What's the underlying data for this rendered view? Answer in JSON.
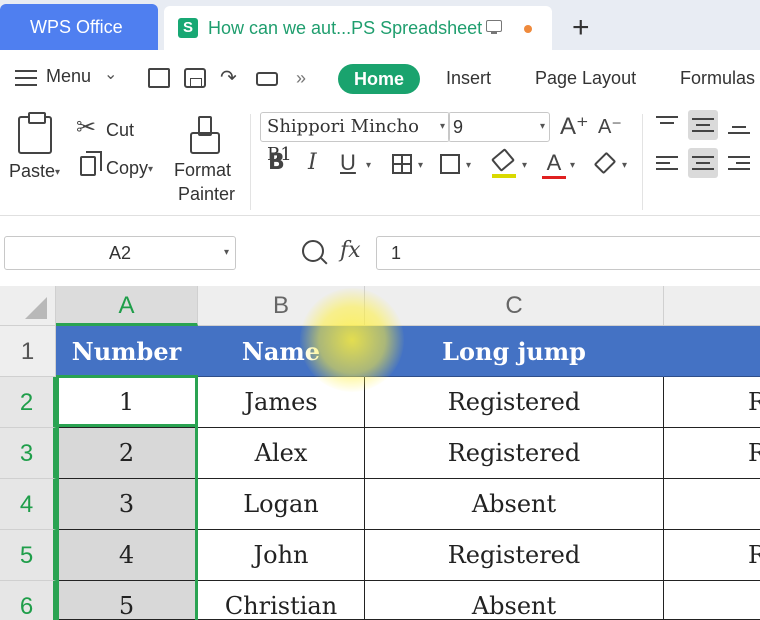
{
  "tabs": {
    "app_tab": "WPS Office",
    "doc_tab": "How can we aut...PS Spreadsheet",
    "new_tab": "+"
  },
  "menu": {
    "menu_label": "Menu",
    "tabs": [
      "Home",
      "Insert",
      "Page Layout",
      "Formulas"
    ],
    "active_tab": "Home"
  },
  "ribbon": {
    "paste": "Paste",
    "cut": "Cut",
    "copy": "Copy",
    "format_painter_line1": "Format",
    "format_painter_line2": "Painter",
    "font_name": "Shippori Mincho B1",
    "font_size": "9",
    "bold": "B",
    "italic": "I",
    "underline": "U",
    "font_color_glyph": "A",
    "grow_font": "A⁺",
    "shrink_font": "A⁻"
  },
  "formula_bar": {
    "name_box": "A2",
    "fx": "fx",
    "value": "1"
  },
  "grid": {
    "columns": [
      "A",
      "B",
      "C"
    ],
    "rows": [
      "1",
      "2",
      "3",
      "4",
      "5",
      "6"
    ],
    "selected_column": "A",
    "header_row": [
      "Number",
      "Name",
      "Long jump"
    ],
    "data_rows": [
      [
        "1",
        "James",
        "Registered",
        "R"
      ],
      [
        "2",
        "Alex",
        "Registered",
        "R"
      ],
      [
        "3",
        "Logan",
        "Absent",
        ""
      ],
      [
        "4",
        "John",
        "Registered",
        "R"
      ],
      [
        "5",
        "Christian",
        "Absent",
        ""
      ]
    ]
  },
  "colors": {
    "accent_green": "#1aa36e",
    "header_fill": "#4472c4",
    "wps_tab": "#4f7ff0",
    "selection": "#2aa352"
  }
}
